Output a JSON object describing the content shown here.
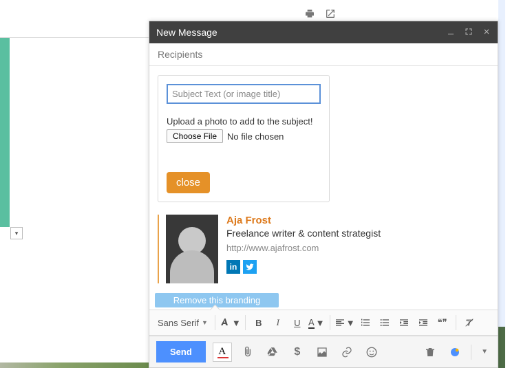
{
  "header": {
    "title": "New Message"
  },
  "recipients": {
    "label": "Recipients"
  },
  "popup": {
    "subject_placeholder": "Subject Text (or image title)",
    "hint": "Upload a photo to add to the subject!",
    "choose_label": "Choose File",
    "nofile_label": "No file chosen",
    "close_label": "close"
  },
  "signature": {
    "name": "Aja Frost",
    "role": "Freelance writer & content strategist",
    "url": "http://www.ajafrost.com",
    "linkedin_icon": "in",
    "twitter_icon": "t"
  },
  "branding": {
    "remove_label": "Remove this branding"
  },
  "format": {
    "font_label": "Sans Serif",
    "bold": "B",
    "italic": "I",
    "underline": "U",
    "color": "A",
    "quote": "❝❞"
  },
  "bottom": {
    "send_label": "Send",
    "text_color": "A",
    "money": "$"
  },
  "bg": {
    "truncated": "2"
  }
}
